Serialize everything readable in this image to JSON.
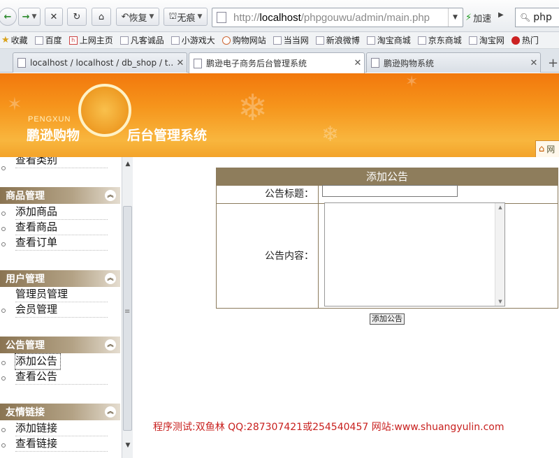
{
  "browser": {
    "nav": {
      "back_icon": "arrow-left-icon",
      "forward_icon": "arrow-right-icon",
      "stop_icon": "close-icon",
      "refresh_icon": "refresh-icon",
      "home_icon": "home-icon",
      "restore_label": "恢复",
      "traceless_label": "无痕"
    },
    "url": {
      "prefix": "http://",
      "host": "localhost",
      "path": "/phpgouwu/admin/main.php"
    },
    "accelerate_label": "加速",
    "search_value": "php"
  },
  "bookmarks": [
    {
      "label": "收藏"
    },
    {
      "label": "百度"
    },
    {
      "label": "上网主页"
    },
    {
      "label": "凡客诚品"
    },
    {
      "label": "小游戏大"
    },
    {
      "label": "购物网站"
    },
    {
      "label": "当当网"
    },
    {
      "label": "新浪微博"
    },
    {
      "label": "淘宝商城"
    },
    {
      "label": "京东商城"
    },
    {
      "label": "淘宝网"
    },
    {
      "label": "热门"
    }
  ],
  "tabs": [
    {
      "label": "localhost / localhost / db_shop / t..."
    },
    {
      "label": "鹏逊电子商务后台管理系统"
    },
    {
      "label": "鹏逊购物系统"
    }
  ],
  "banner": {
    "logo_sub": "PENGXUN",
    "logo_text": "鹏逊购物",
    "system_title": "后台管理系统",
    "home_tab_label": "网"
  },
  "sidebar": {
    "top_partial_item": "查看类别",
    "groups": [
      {
        "title": "商品管理",
        "items": [
          "添加商品",
          "查看商品",
          "查看订单"
        ]
      },
      {
        "title": "用户管理",
        "items": [
          "管理员管理",
          "会员管理"
        ]
      },
      {
        "title": "公告管理",
        "items": [
          "添加公告",
          "查看公告"
        ]
      },
      {
        "title": "友情链接",
        "items": [
          "添加链接",
          "查看链接"
        ]
      }
    ]
  },
  "form": {
    "header": "添加公告",
    "title_label": "公告标题：",
    "title_value": "",
    "content_label": "公告内容：",
    "content_value": "",
    "submit_label": "添加公告"
  },
  "footer": {
    "note": "程序测试:双鱼林 QQ:287307421或254540457 网站:www.shuangyulin.com"
  },
  "colors": {
    "banner_orange": "#f6951c",
    "table_header_brown": "#8e7d5c",
    "footer_red": "#c8201e"
  }
}
